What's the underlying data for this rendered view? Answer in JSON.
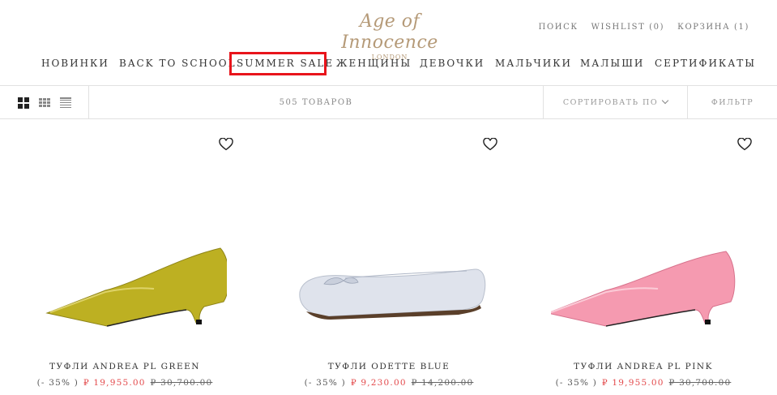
{
  "brand": {
    "name": "Age of Innocence",
    "sub": "LONDON",
    "color": "#b59a78"
  },
  "util_nav": [
    "ПОИСК",
    "WISHLIST (0)",
    "КОРЗИНА (1)"
  ],
  "main_nav": [
    "НОВИНКИ",
    "BACK TO SCHOOL",
    "SUMMER SALE",
    "ЖЕНЩИНЫ",
    "ДЕВОЧКИ",
    "МАЛЬЧИКИ",
    "МАЛЫШИ",
    "СЕРТИФИКАТЫ"
  ],
  "highlight_color": "#e8141b",
  "toolbar": {
    "count": "505 ТОВАРОВ",
    "sort_label": "СОРТИРОВАТЬ ПО",
    "filter_label": "ФИЛЬТР"
  },
  "products": [
    {
      "name": "ТУФЛИ ANDREA PL GREEN",
      "discount": "(- 35% )",
      "price": "₽ 19,955.00",
      "old_price": "₽ 30,700.00",
      "color": "#bdb022"
    },
    {
      "name": "ТУФЛИ ODETTE BLUE",
      "discount": "(- 35% )",
      "price": "₽ 9,230.00",
      "old_price": "₽ 14,200.00",
      "color": "#dfe3ec"
    },
    {
      "name": "ТУФЛИ ANDREA PL PINK",
      "discount": "(- 35% )",
      "price": "₽ 19,955.00",
      "old_price": "₽ 30,700.00",
      "color": "#f59ab0"
    }
  ],
  "sale_price_color": "#e3484a"
}
